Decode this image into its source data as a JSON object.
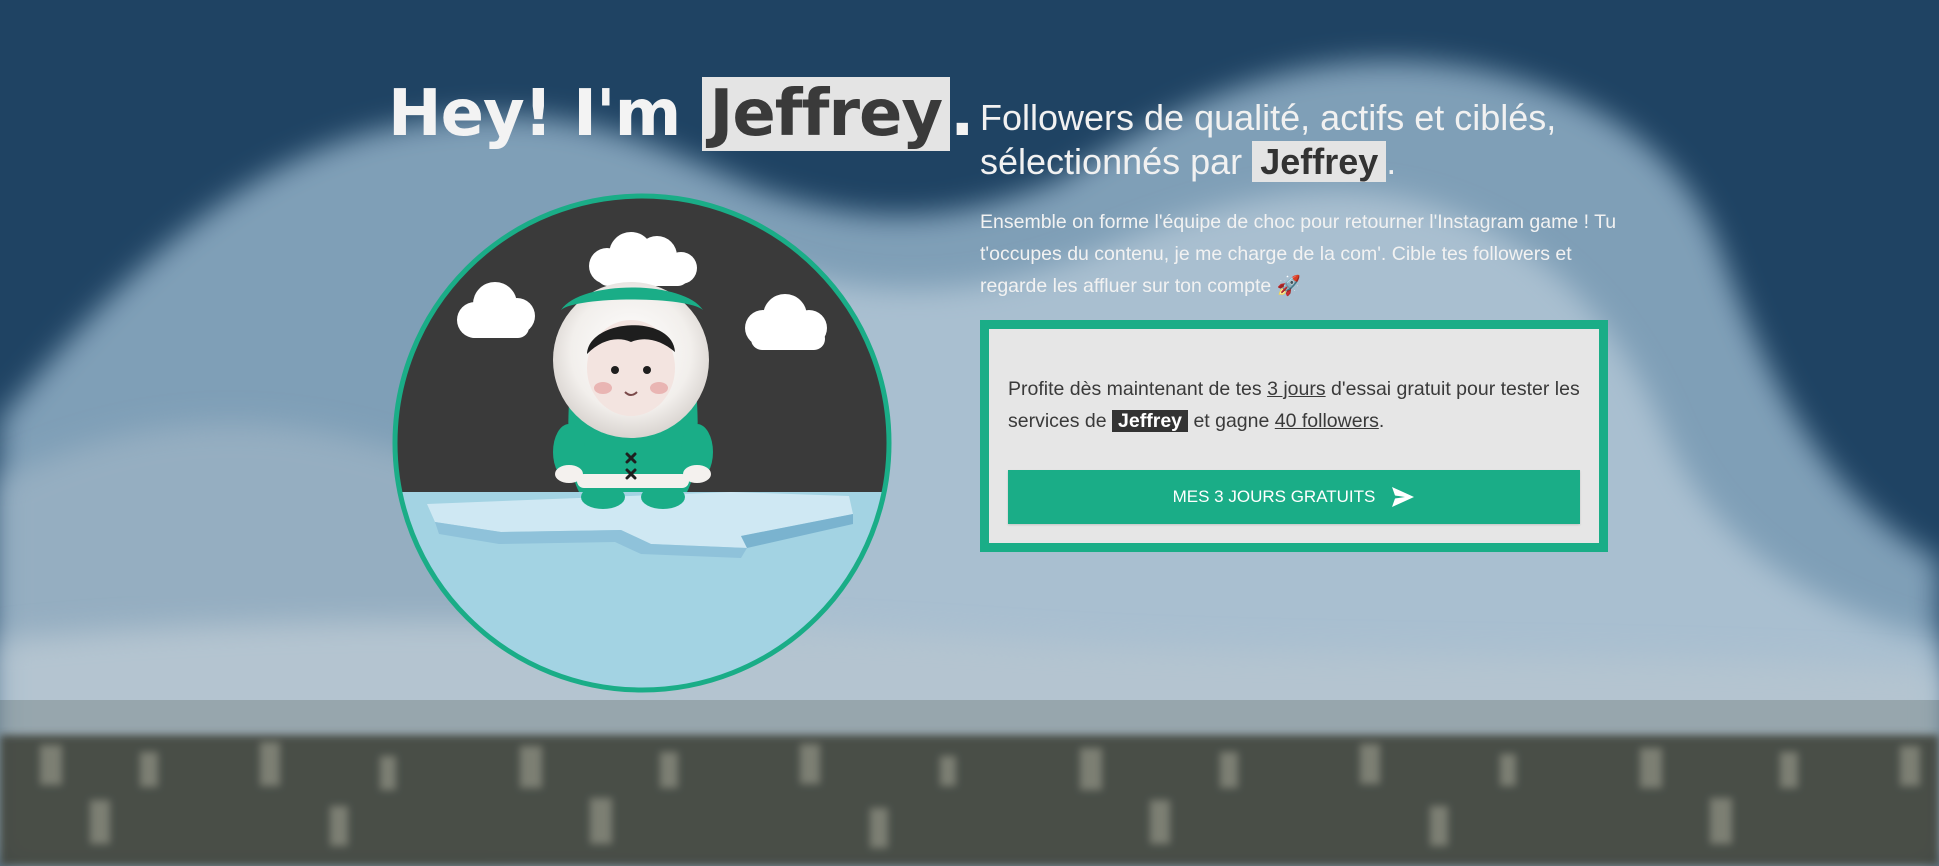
{
  "hero": {
    "title_prefix": "Hey! I'm",
    "title_name": "Jeffrey",
    "title_suffix": ".",
    "headline_line1": "Followers de qualité, actifs et ciblés,",
    "headline_line2_prefix": "sélectionnés par",
    "headline_name": "Jeffrey",
    "headline_suffix": ".",
    "intro": "Ensemble on forme l'équipe de choc pour retourner l'Instagram game ! Tu t'occupes du contenu, je me charge de la com'. Cible tes followers et regarde les affluer sur ton compte",
    "intro_emoji": "🚀"
  },
  "trial": {
    "text_part1": "Profite dès maintenant de tes",
    "days_link": "3 jours",
    "text_part2": "d'essai gratuit pour tester les services de",
    "brand": "Jeffrey",
    "text_part3": "et gagne",
    "followers_link": "40 followers",
    "text_part4": ".",
    "cta_label": "MES 3 JOURS GRATUITS",
    "cta_icon": "send-icon"
  },
  "colors": {
    "accent": "#1aad87",
    "highlight_bg": "#e4e4e4",
    "dark_text": "#333333",
    "night_sky": "#3a3a3a",
    "ice_water": "#a3d3e3"
  }
}
